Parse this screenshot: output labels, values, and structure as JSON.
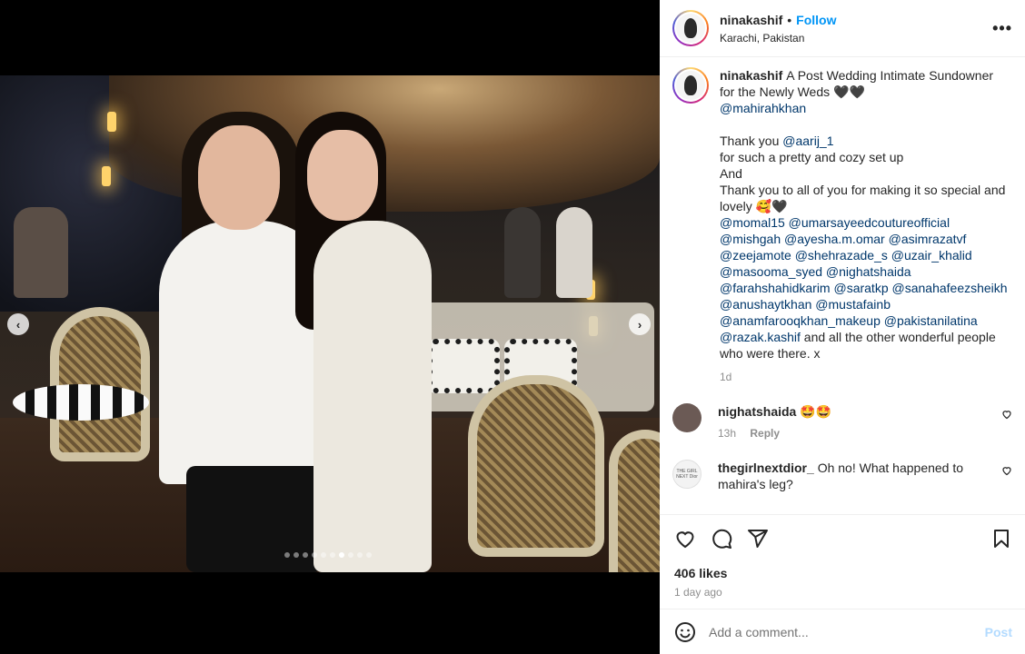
{
  "post": {
    "username": "ninakashif",
    "separator": "•",
    "follow_label": "Follow",
    "location": "Karachi, Pakistan",
    "more_label": "•••",
    "carousel": {
      "total": 10,
      "active_index": 6
    }
  },
  "caption": {
    "username": "ninakashif",
    "line1": "A Post Wedding Intimate Sundowner for the Newly Weds 🖤🖤",
    "mention1": "@mahirahkhan",
    "thanks1": "Thank you ",
    "mention2": "@aarij_1",
    "line2": "for such a pretty and cozy set up",
    "line3": "And",
    "line4": "Thank you to all of you for making it so special and lovely 🥰🖤",
    "mentions_block": "@momal15 @umarsayeedcoutureofficial @mishgah @ayesha.m.omar @asimrazatvf @zeejamote @shehrazade_s @uzair_khalid @masooma_syed @nighatshaida @farahshahidkarim @saratkp @sanahafeezsheikh @anushaytkhan @mustafainb @anamfarooqkhan_makeup @pakistanilatina @razak.kashif",
    "closing": " and all the other wonderful people who were there. x",
    "time": "1d"
  },
  "comments": [
    {
      "username": "nighatshaida",
      "text": "🤩🤩",
      "time": "13h",
      "reply_label": "Reply"
    },
    {
      "username": "thegirlnextdior_",
      "text": "Oh no! What happened to mahira's leg?",
      "avatar_text": "THE GIRL NEXT Dior"
    }
  ],
  "actions": {
    "likes": "406 likes",
    "date": "1 day ago"
  },
  "comment_box": {
    "placeholder": "Add a comment...",
    "post_label": "Post"
  }
}
